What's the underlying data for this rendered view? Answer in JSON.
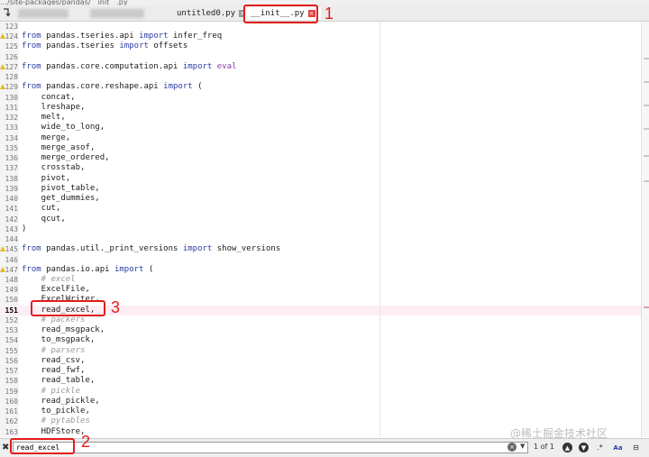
{
  "titlebar": {
    "path": "…/site-packages/pandas/__init__.py"
  },
  "tabs": [
    {
      "label": "untitled0.py",
      "active": false
    },
    {
      "label": "__init__.py",
      "active": true
    }
  ],
  "annotations": {
    "one": "1",
    "two": "2",
    "three": "3"
  },
  "current_line": 151,
  "code_lines": [
    {
      "n": "123",
      "tokens": []
    },
    {
      "n": "124",
      "warn": true,
      "tokens": [
        [
          "kw",
          "from"
        ],
        [
          "t",
          " pandas.tseries.api "
        ],
        [
          "kw",
          "import"
        ],
        [
          "t",
          " infer_freq"
        ]
      ]
    },
    {
      "n": "125",
      "tokens": [
        [
          "kw",
          "from"
        ],
        [
          "t",
          " pandas.tseries "
        ],
        [
          "kw",
          "import"
        ],
        [
          "t",
          " offsets"
        ]
      ]
    },
    {
      "n": "126",
      "tokens": []
    },
    {
      "n": "127",
      "warn": true,
      "tokens": [
        [
          "kw",
          "from"
        ],
        [
          "t",
          " pandas.core.computation.api "
        ],
        [
          "kw",
          "import"
        ],
        [
          "t",
          " "
        ],
        [
          "kw2",
          "eval"
        ]
      ]
    },
    {
      "n": "128",
      "tokens": []
    },
    {
      "n": "129",
      "warn": true,
      "tokens": [
        [
          "kw",
          "from"
        ],
        [
          "t",
          " pandas.core.reshape.api "
        ],
        [
          "kw",
          "import"
        ],
        [
          "t",
          " ("
        ]
      ]
    },
    {
      "n": "130",
      "tokens": [
        [
          "t",
          "    concat,"
        ]
      ]
    },
    {
      "n": "131",
      "tokens": [
        [
          "t",
          "    lreshape,"
        ]
      ]
    },
    {
      "n": "132",
      "tokens": [
        [
          "t",
          "    melt,"
        ]
      ]
    },
    {
      "n": "133",
      "tokens": [
        [
          "t",
          "    wide_to_long,"
        ]
      ]
    },
    {
      "n": "134",
      "tokens": [
        [
          "t",
          "    merge,"
        ]
      ]
    },
    {
      "n": "135",
      "tokens": [
        [
          "t",
          "    merge_asof,"
        ]
      ]
    },
    {
      "n": "136",
      "tokens": [
        [
          "t",
          "    merge_ordered,"
        ]
      ]
    },
    {
      "n": "137",
      "tokens": [
        [
          "t",
          "    crosstab,"
        ]
      ]
    },
    {
      "n": "138",
      "tokens": [
        [
          "t",
          "    pivot,"
        ]
      ]
    },
    {
      "n": "139",
      "tokens": [
        [
          "t",
          "    pivot_table,"
        ]
      ]
    },
    {
      "n": "140",
      "tokens": [
        [
          "t",
          "    get_dummies,"
        ]
      ]
    },
    {
      "n": "141",
      "tokens": [
        [
          "t",
          "    cut,"
        ]
      ]
    },
    {
      "n": "142",
      "tokens": [
        [
          "t",
          "    qcut,"
        ]
      ]
    },
    {
      "n": "143",
      "tokens": [
        [
          "t",
          ")"
        ]
      ]
    },
    {
      "n": "144",
      "tokens": []
    },
    {
      "n": "145",
      "warn": true,
      "tokens": [
        [
          "kw",
          "from"
        ],
        [
          "t",
          " pandas.util._print_versions "
        ],
        [
          "kw",
          "import"
        ],
        [
          "t",
          " show_versions"
        ]
      ]
    },
    {
      "n": "146",
      "tokens": []
    },
    {
      "n": "147",
      "warn": true,
      "tokens": [
        [
          "kw",
          "from"
        ],
        [
          "t",
          " pandas.io.api "
        ],
        [
          "kw",
          "import"
        ],
        [
          "t",
          " ("
        ]
      ]
    },
    {
      "n": "148",
      "tokens": [
        [
          "cm",
          "    # excel"
        ]
      ]
    },
    {
      "n": "149",
      "tokens": [
        [
          "t",
          "    ExcelFile,"
        ]
      ]
    },
    {
      "n": "150",
      "tokens": [
        [
          "t",
          "    ExcelWriter,"
        ]
      ]
    },
    {
      "n": "151",
      "tokens": [
        [
          "t",
          "    read_excel,"
        ]
      ]
    },
    {
      "n": "152",
      "tokens": [
        [
          "cm",
          "    # packers"
        ]
      ]
    },
    {
      "n": "153",
      "tokens": [
        [
          "t",
          "    read_msgpack,"
        ]
      ]
    },
    {
      "n": "154",
      "tokens": [
        [
          "t",
          "    to_msgpack,"
        ]
      ]
    },
    {
      "n": "155",
      "tokens": [
        [
          "cm",
          "    # parsers"
        ]
      ]
    },
    {
      "n": "156",
      "tokens": [
        [
          "t",
          "    read_csv,"
        ]
      ]
    },
    {
      "n": "157",
      "tokens": [
        [
          "t",
          "    read_fwf,"
        ]
      ]
    },
    {
      "n": "158",
      "tokens": [
        [
          "t",
          "    read_table,"
        ]
      ]
    },
    {
      "n": "159",
      "tokens": [
        [
          "cm",
          "    # pickle"
        ]
      ]
    },
    {
      "n": "160",
      "tokens": [
        [
          "t",
          "    read_pickle,"
        ]
      ]
    },
    {
      "n": "161",
      "tokens": [
        [
          "t",
          "    to_pickle,"
        ]
      ]
    },
    {
      "n": "162",
      "tokens": [
        [
          "cm",
          "    # pytables"
        ]
      ]
    },
    {
      "n": "163",
      "tokens": [
        [
          "t",
          "    HDFStore,"
        ]
      ]
    }
  ],
  "find": {
    "value": "read_excel",
    "count": "1 of 1",
    "case_label": "Aa",
    "close_icon": "close-icon",
    "prev_icon": "arrow-up-icon",
    "next_icon": "arrow-down-icon"
  },
  "watermark": "@稀土掘金技术社区",
  "colors": {
    "annotation": "#e21d1d",
    "keyword": "#2d3fa6",
    "comment": "#999999",
    "current_line": "#fdeef5"
  }
}
